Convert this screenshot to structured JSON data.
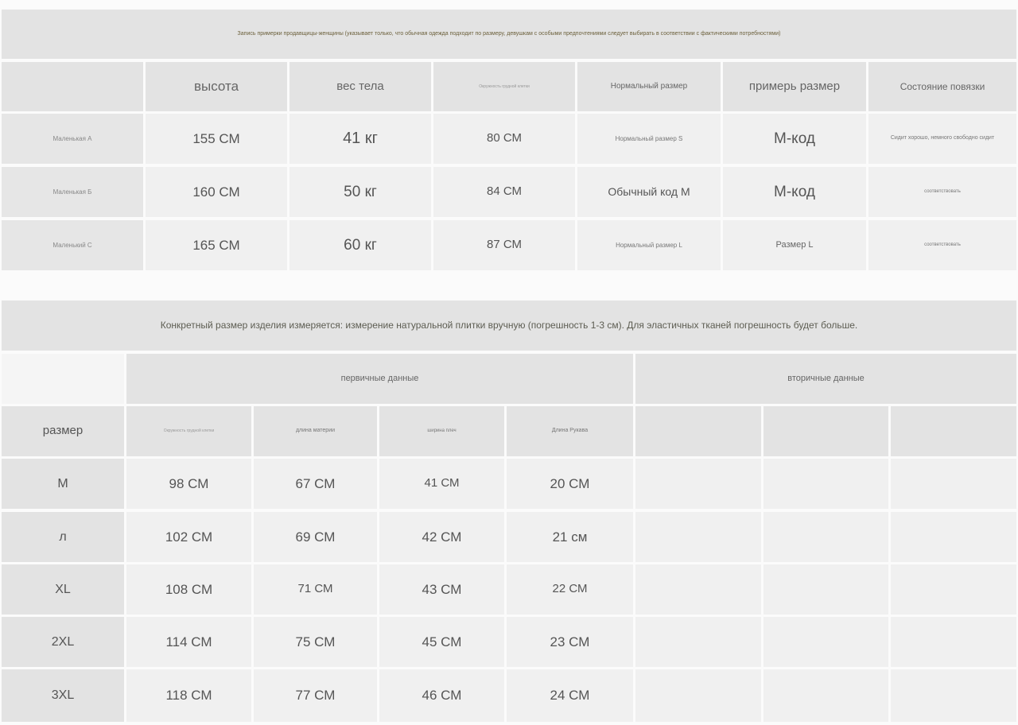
{
  "fitting_table": {
    "banner": "Запись примерки продавщицы-женщины (указывает только, что обычная одежда подходит по размеру, девушкам с особыми предпочтениями следует выбирать в соответствии с фактическими потребностями)",
    "headers": [
      "",
      "высота",
      "вес тела",
      "Окружность грудной клетки",
      "Нормальный размер",
      "примерь размер",
      "Состояние повязки"
    ],
    "rows": [
      {
        "name": "Маленькая А",
        "height": "155 СМ",
        "weight": "41 кг",
        "bust": "80 СМ",
        "normal_size": "Нормальный размер S",
        "try_size": "М-код",
        "status": "Сидит хорошо, немного свободно сидит"
      },
      {
        "name": "Маленькая Б",
        "height": "160 СМ",
        "weight": "50 кг",
        "bust": "84 СМ",
        "normal_size": "Обычный код М",
        "try_size": "М-код",
        "status": "соответствовать"
      },
      {
        "name": "Маленький С",
        "height": "165 СМ",
        "weight": "60 кг",
        "bust": "87 СМ",
        "normal_size": "Нормальный размер L",
        "try_size": "Размер L",
        "status": "соответствовать"
      }
    ]
  },
  "size_table": {
    "banner": "Конкретный размер изделия измеряется: измерение натуральной плитки вручную (погрешность 1-3 см). Для эластичных тканей погрешность будет больше.",
    "group_primary": "первичные данные",
    "group_secondary": "вторичные данные",
    "size_label": "размер",
    "sub_headers": [
      "Окружность грудной клетки",
      "длина материи",
      "ширина плеч",
      "Длина Рукава"
    ],
    "rows": [
      {
        "size": "M",
        "c1": "98 СМ",
        "c2": "67 СМ",
        "c3": "41 СМ",
        "c4": "20 СМ"
      },
      {
        "size": "л",
        "c1": "102 СМ",
        "c2": "69 СМ",
        "c3": "42 СМ",
        "c4": "21 см"
      },
      {
        "size": "XL",
        "c1": "108 СМ",
        "c2": "71 СМ",
        "c3": "43 СМ",
        "c4": "22 СМ"
      },
      {
        "size": "2XL",
        "c1": "114 СМ",
        "c2": "75 СМ",
        "c3": "45 СМ",
        "c4": "23 СМ"
      },
      {
        "size": "3XL",
        "c1": "118 СМ",
        "c2": "77 СМ",
        "c3": "46 СМ",
        "c4": "24 СМ"
      }
    ]
  }
}
